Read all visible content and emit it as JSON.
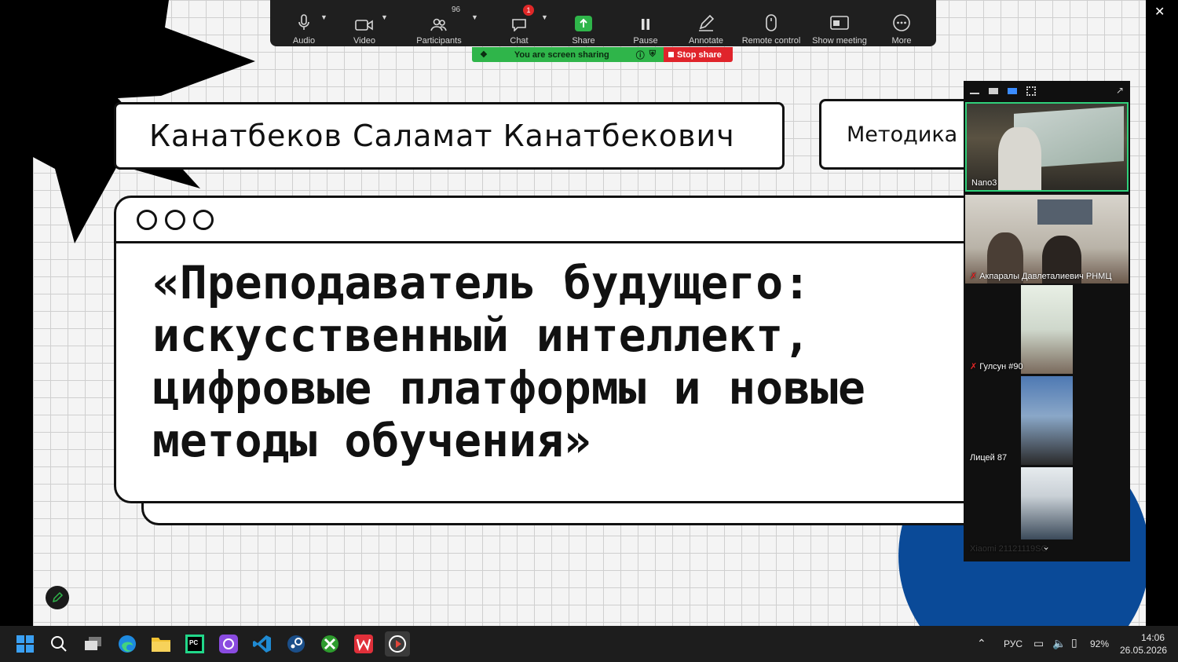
{
  "zoom_toolbar": {
    "items": [
      {
        "label": "Audio",
        "icon": "microphone-icon"
      },
      {
        "label": "Video",
        "icon": "video-camera-icon"
      },
      {
        "label": "Participants",
        "icon": "participants-icon",
        "count": "96"
      },
      {
        "label": "Chat",
        "icon": "chat-icon",
        "badge": "1"
      },
      {
        "label": "Share",
        "icon": "share-screen-icon"
      },
      {
        "label": "Pause",
        "icon": "pause-icon"
      },
      {
        "label": "Annotate",
        "icon": "pencil-icon"
      },
      {
        "label": "Remote control",
        "icon": "mouse-icon"
      },
      {
        "label": "Show meeting",
        "icon": "show-meeting-icon"
      },
      {
        "label": "More",
        "icon": "more-icon"
      }
    ],
    "sharing_text": "You are screen sharing",
    "stop_share_label": "Stop share"
  },
  "slide": {
    "author": "Канатбеков Саламат Канатбекович",
    "subject": "Методика",
    "title": "«Преподаватель будущего:\nискусственный интеллект,\nцифровые платформы и новые\nметоды обучения»",
    "colors": {
      "grid_bg": "#f4f4f4",
      "accent_blue": "#0a4a98",
      "ink": "#111111"
    }
  },
  "video_panel": {
    "participants": [
      {
        "name": "Nano3",
        "muted": false
      },
      {
        "name": "Акпаралы Давлеталиевич РНМЦ",
        "muted": true
      },
      {
        "name": "Гулсун #90",
        "muted": true
      },
      {
        "name": "Лицей 87",
        "muted": false
      },
      {
        "name": "Xiaomi 21121119SG",
        "muted": false
      }
    ]
  },
  "taskbar": {
    "apps": [
      "start-icon",
      "search-icon",
      "task-view-icon",
      "edge-icon",
      "file-explorer-icon",
      "pycharm-icon",
      "app-icon",
      "vscode-icon",
      "steam-icon",
      "xbox-icon",
      "wps-icon",
      "media-player-icon"
    ],
    "language": "РУС",
    "battery": "92%",
    "time": "14:06",
    "date": "26.05.2026"
  }
}
